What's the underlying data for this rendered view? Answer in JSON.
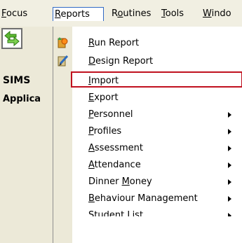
{
  "menubar": {
    "items": [
      {
        "pre": "",
        "u": "F",
        "post": "ocus"
      },
      {
        "pre": "",
        "u": "R",
        "post": "eports"
      },
      {
        "pre": "R",
        "u": "o",
        "post": "utines"
      },
      {
        "pre": "",
        "u": "T",
        "post": "ools"
      },
      {
        "pre": "",
        "u": "W",
        "post": "indo"
      }
    ]
  },
  "sidebar": {
    "title": "SIMS",
    "subtitle": "Applica"
  },
  "reports_menu": {
    "items": [
      {
        "pre": "",
        "u": "R",
        "post": "un Report",
        "submenu": false
      },
      {
        "pre": "",
        "u": "D",
        "post": "esign Report",
        "submenu": false
      },
      {
        "pre": "",
        "u": "I",
        "post": "mport",
        "submenu": false
      },
      {
        "pre": "",
        "u": "E",
        "post": "xport",
        "submenu": false
      },
      {
        "pre": "",
        "u": "P",
        "post": "ersonnel",
        "submenu": true
      },
      {
        "pre": "",
        "u": "P",
        "post": "rofiles",
        "submenu": true
      },
      {
        "pre": "",
        "u": "A",
        "post": "ssessment",
        "submenu": true
      },
      {
        "pre": "",
        "u": "A",
        "post": "ttendance",
        "submenu": true
      },
      {
        "pre": "Dinner ",
        "u": "M",
        "post": "oney",
        "submenu": true
      },
      {
        "pre": "",
        "u": "B",
        "post": "ehaviour Management",
        "submenu": true
      },
      {
        "pre": "",
        "u": "S",
        "post": "tudent List",
        "submenu": true
      }
    ]
  }
}
